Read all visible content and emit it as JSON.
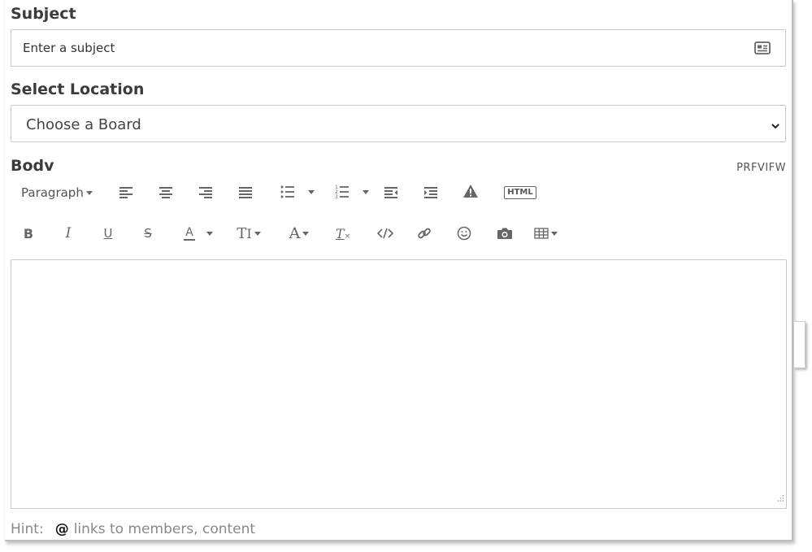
{
  "subject": {
    "label": "Subject",
    "placeholder": "Enter a subject",
    "icon": "contact-card-icon"
  },
  "location": {
    "label": "Select Location",
    "selected": "Choose a Board"
  },
  "body": {
    "label": "Bodv",
    "preview_label": "PRFVIFW"
  },
  "toolbar": {
    "paragraph_label": "Paragraph",
    "html_label": "HTML",
    "bold_label": "B",
    "italic_label": "I",
    "underline_label": "U",
    "strike_label": "S",
    "font_color_label": "A",
    "font_size_label": "T",
    "font_family_label": "A",
    "clear_format_label": "T"
  },
  "hint": {
    "prefix": "Hint:",
    "symbol": "@",
    "text": "links to members, content"
  },
  "colors": {
    "icon": "#666666",
    "border": "#c8c8c8",
    "label": "#3b3b3b"
  }
}
